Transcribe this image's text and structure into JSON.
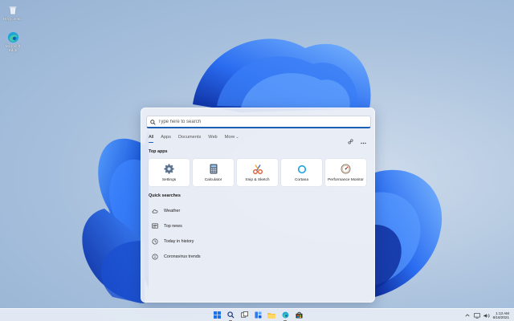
{
  "desktop": {
    "icons": [
      {
        "name": "recycle-bin",
        "label": "Recycle Bin"
      },
      {
        "name": "microsoft-edge",
        "label": "Microsoft Edge"
      }
    ]
  },
  "search": {
    "placeholder": "Type here to search",
    "tabs": [
      {
        "label": "All",
        "active": true
      },
      {
        "label": "Apps",
        "active": false
      },
      {
        "label": "Documents",
        "active": false
      },
      {
        "label": "Web",
        "active": false
      },
      {
        "label": "More",
        "active": false,
        "icon": "chevron-down-icon"
      }
    ],
    "header_icons": [
      "share-icon",
      "more-icon"
    ],
    "top_apps_title": "Top apps",
    "top_apps": [
      {
        "label": "Settings",
        "icon": "settings-gear-icon"
      },
      {
        "label": "Calculator",
        "icon": "calculator-icon"
      },
      {
        "label": "Snip & Sketch",
        "icon": "snip-sketch-icon"
      },
      {
        "label": "Cortana",
        "icon": "cortana-ring-icon"
      },
      {
        "label": "Performance Monitor",
        "icon": "performance-monitor-icon"
      }
    ],
    "quick_searches_title": "Quick searches",
    "quick_searches": [
      {
        "label": "Weather",
        "icon": "weather-cloud-icon"
      },
      {
        "label": "Top news",
        "icon": "news-icon"
      },
      {
        "label": "Today in history",
        "icon": "clock-icon"
      },
      {
        "label": "Coronavirus trends",
        "icon": "info-icon"
      }
    ]
  },
  "taskbar": {
    "apps": [
      {
        "name": "start",
        "icon": "windows-logo-icon"
      },
      {
        "name": "search",
        "icon": "search-icon"
      },
      {
        "name": "task-view",
        "icon": "task-view-icon"
      },
      {
        "name": "widgets",
        "icon": "widgets-icon"
      },
      {
        "name": "file-explorer",
        "icon": "folder-icon"
      },
      {
        "name": "edge",
        "icon": "edge-icon"
      },
      {
        "name": "store",
        "icon": "store-bag-icon"
      }
    ],
    "tray_icons": [
      "chevron-up-icon",
      "network-icon",
      "volume-icon"
    ],
    "time": "1:13 AM",
    "date": "6/16/2021"
  },
  "colors": {
    "accent": "#1a5fb4",
    "wallpaper_bloom": "#1f5fe0",
    "panel": "#eceff6"
  }
}
